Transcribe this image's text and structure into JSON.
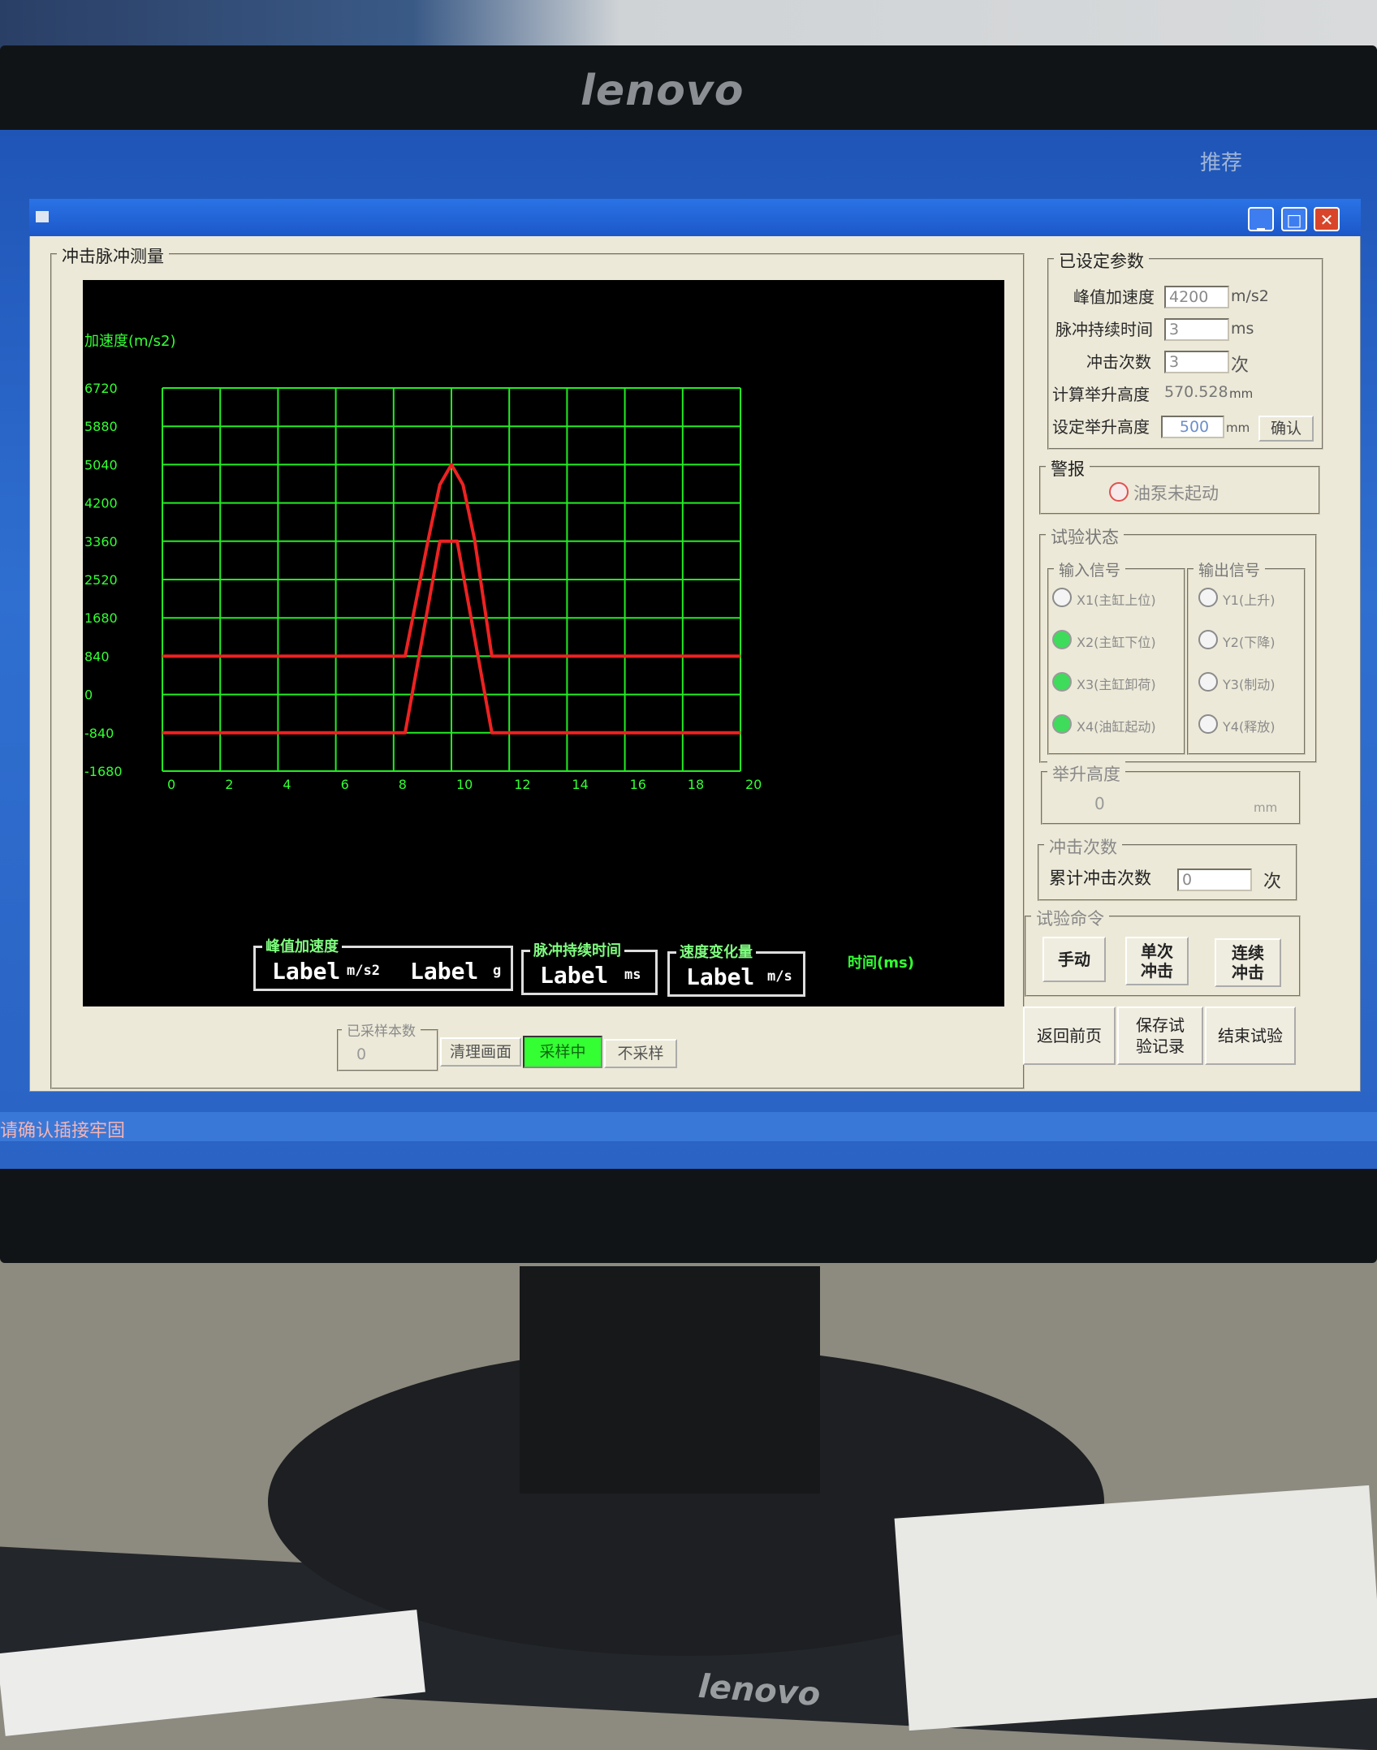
{
  "monitor": {
    "brand_top": "lenovo",
    "brand_bottom": "lenovo"
  },
  "desktop": {
    "corner_text": "推荐",
    "taskbar_text": "请确认插接牢固"
  },
  "measure_group": {
    "title": "冲击脉冲测量",
    "sample_count_label": "已采样本数",
    "sample_count_value": "0",
    "clear_button": "清理画面",
    "sampling_button": "采样中",
    "stop_sampling_button": "不采样",
    "sampling_active_color": "#33ff33"
  },
  "readouts": {
    "peak_accel_title": "峰值加速度",
    "peak_accel_value1": "Label",
    "peak_accel_unit1": "m/s2",
    "peak_accel_value2": "Label",
    "peak_accel_unit2": "g",
    "pulse_duration_title": "脉冲持续时间",
    "pulse_duration_value": "Label",
    "pulse_duration_unit": "ms",
    "velocity_change_title": "速度变化量",
    "velocity_change_value": "Label",
    "velocity_change_unit": "m/s"
  },
  "chart_data": {
    "type": "line",
    "ylabel": "加速度(m/s2)",
    "xlabel": "时间(ms)",
    "xlim": [
      0,
      20
    ],
    "ylim": [
      -1680,
      6720
    ],
    "x_ticks": [
      0,
      2,
      4,
      6,
      8,
      10,
      12,
      14,
      16,
      18,
      20
    ],
    "y_ticks": [
      6720,
      5880,
      5040,
      4200,
      3360,
      2520,
      1680,
      840,
      0,
      -840,
      -1680
    ],
    "grid": true,
    "grid_color": "#22ee22",
    "line_color": "#ee2222",
    "series": [
      {
        "x": [
          0,
          8.4,
          9.2,
          9.6,
          10.0,
          10.4,
          10.8,
          11.4,
          20
        ],
        "y": [
          840,
          840,
          3400,
          4600,
          5040,
          4600,
          3400,
          840,
          840
        ]
      },
      {
        "x": [
          0,
          8.4,
          9.6,
          10.2,
          11.4,
          20
        ],
        "y": [
          -840,
          -840,
          3360,
          3360,
          -840,
          -840
        ]
      }
    ]
  },
  "params": {
    "title": "已设定参数",
    "peak_accel_label": "峰值加速度",
    "peak_accel_value": "4200",
    "peak_accel_unit": "m/s2",
    "pulse_time_label": "脉冲持续时间",
    "pulse_time_value": "3",
    "pulse_time_unit": "ms",
    "impact_count_label": "冲击次数",
    "impact_count_value": "3",
    "impact_count_unit": "次",
    "calc_height_label": "计算举升高度",
    "calc_height_value": "570.528",
    "calc_height_unit": "mm",
    "set_height_label": "设定举升高度",
    "set_height_value": "500",
    "set_height_unit": "mm",
    "confirm_button": "确认"
  },
  "alarm": {
    "title": "警报",
    "text": "油泵未起动"
  },
  "test_status": {
    "title": "试验状态",
    "input_title": "输入信号",
    "output_title": "输出信号",
    "inputs": [
      {
        "label": "X1(主缸上位)",
        "on": false
      },
      {
        "label": "X2(主缸下位)",
        "on": true
      },
      {
        "label": "X3(主缸卸荷)",
        "on": true
      },
      {
        "label": "X4(油缸起动)",
        "on": true
      }
    ],
    "outputs": [
      {
        "label": "Y1(上升)",
        "on": false
      },
      {
        "label": "Y2(下降)",
        "on": false
      },
      {
        "label": "Y3(制动)",
        "on": false
      },
      {
        "label": "Y4(释放)",
        "on": false
      }
    ]
  },
  "lift_height": {
    "title": "举升高度",
    "value": "0",
    "unit": "mm"
  },
  "impacts": {
    "title": "冲击次数",
    "label": "累计冲击次数",
    "value": "0",
    "unit": "次"
  },
  "commands": {
    "title": "试验命令",
    "manual": "手动",
    "single_line1": "单次",
    "single_line2": "冲击",
    "continuous_line1": "连续",
    "continuous_line2": "冲击",
    "back": "返回前页",
    "save_line1": "保存试",
    "save_line2": "验记录",
    "end": "结束试验"
  }
}
